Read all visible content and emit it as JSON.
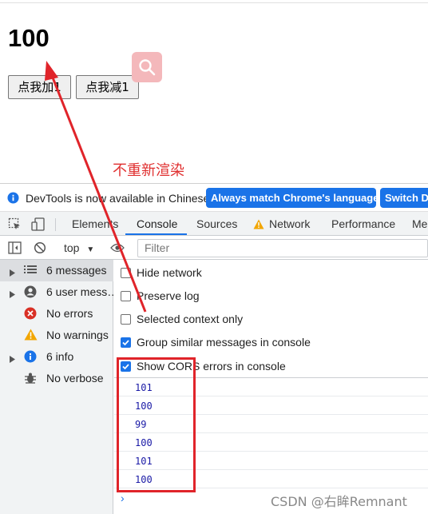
{
  "page": {
    "counter": "100",
    "add_button": "点我加1",
    "sub_button": "点我减1",
    "annotation": "不重新渲染"
  },
  "devtools": {
    "infobar": {
      "text": "DevTools is now available in Chinese!",
      "match_button": "Always match Chrome's language",
      "switch_button": "Switch De"
    },
    "tabs": [
      "Elements",
      "Console",
      "Sources",
      "Network",
      "Performance",
      "Me"
    ],
    "active_tab": "Console",
    "filter": {
      "context": "top",
      "placeholder": "Filter"
    },
    "sidebar": [
      {
        "label": "6 messages",
        "icon": "list-icon",
        "expandable": true,
        "selected": true
      },
      {
        "label": "6 user mess…",
        "icon": "user-icon",
        "expandable": true,
        "selected": false
      },
      {
        "label": "No errors",
        "icon": "error-icon",
        "expandable": false,
        "selected": false
      },
      {
        "label": "No warnings",
        "icon": "warning-icon",
        "expandable": false,
        "selected": false
      },
      {
        "label": "6 info",
        "icon": "info-icon",
        "expandable": true,
        "selected": false
      },
      {
        "label": "No verbose",
        "icon": "bug-icon",
        "expandable": false,
        "selected": false
      }
    ],
    "settings": [
      {
        "label": "Hide network",
        "checked": false
      },
      {
        "label": "Preserve log",
        "checked": false
      },
      {
        "label": "Selected context only",
        "checked": false
      },
      {
        "label": "Group similar messages in console",
        "checked": true
      },
      {
        "label": "Show CORS errors in console",
        "checked": true
      }
    ],
    "logs": [
      "101",
      "100",
      "99",
      "100",
      "101",
      "100"
    ]
  },
  "watermark": "CSDN @右眸Remnant",
  "colors": {
    "accent": "#1a73e8",
    "annotation_red": "#e0242a",
    "log_blue": "#1a1aa6"
  }
}
